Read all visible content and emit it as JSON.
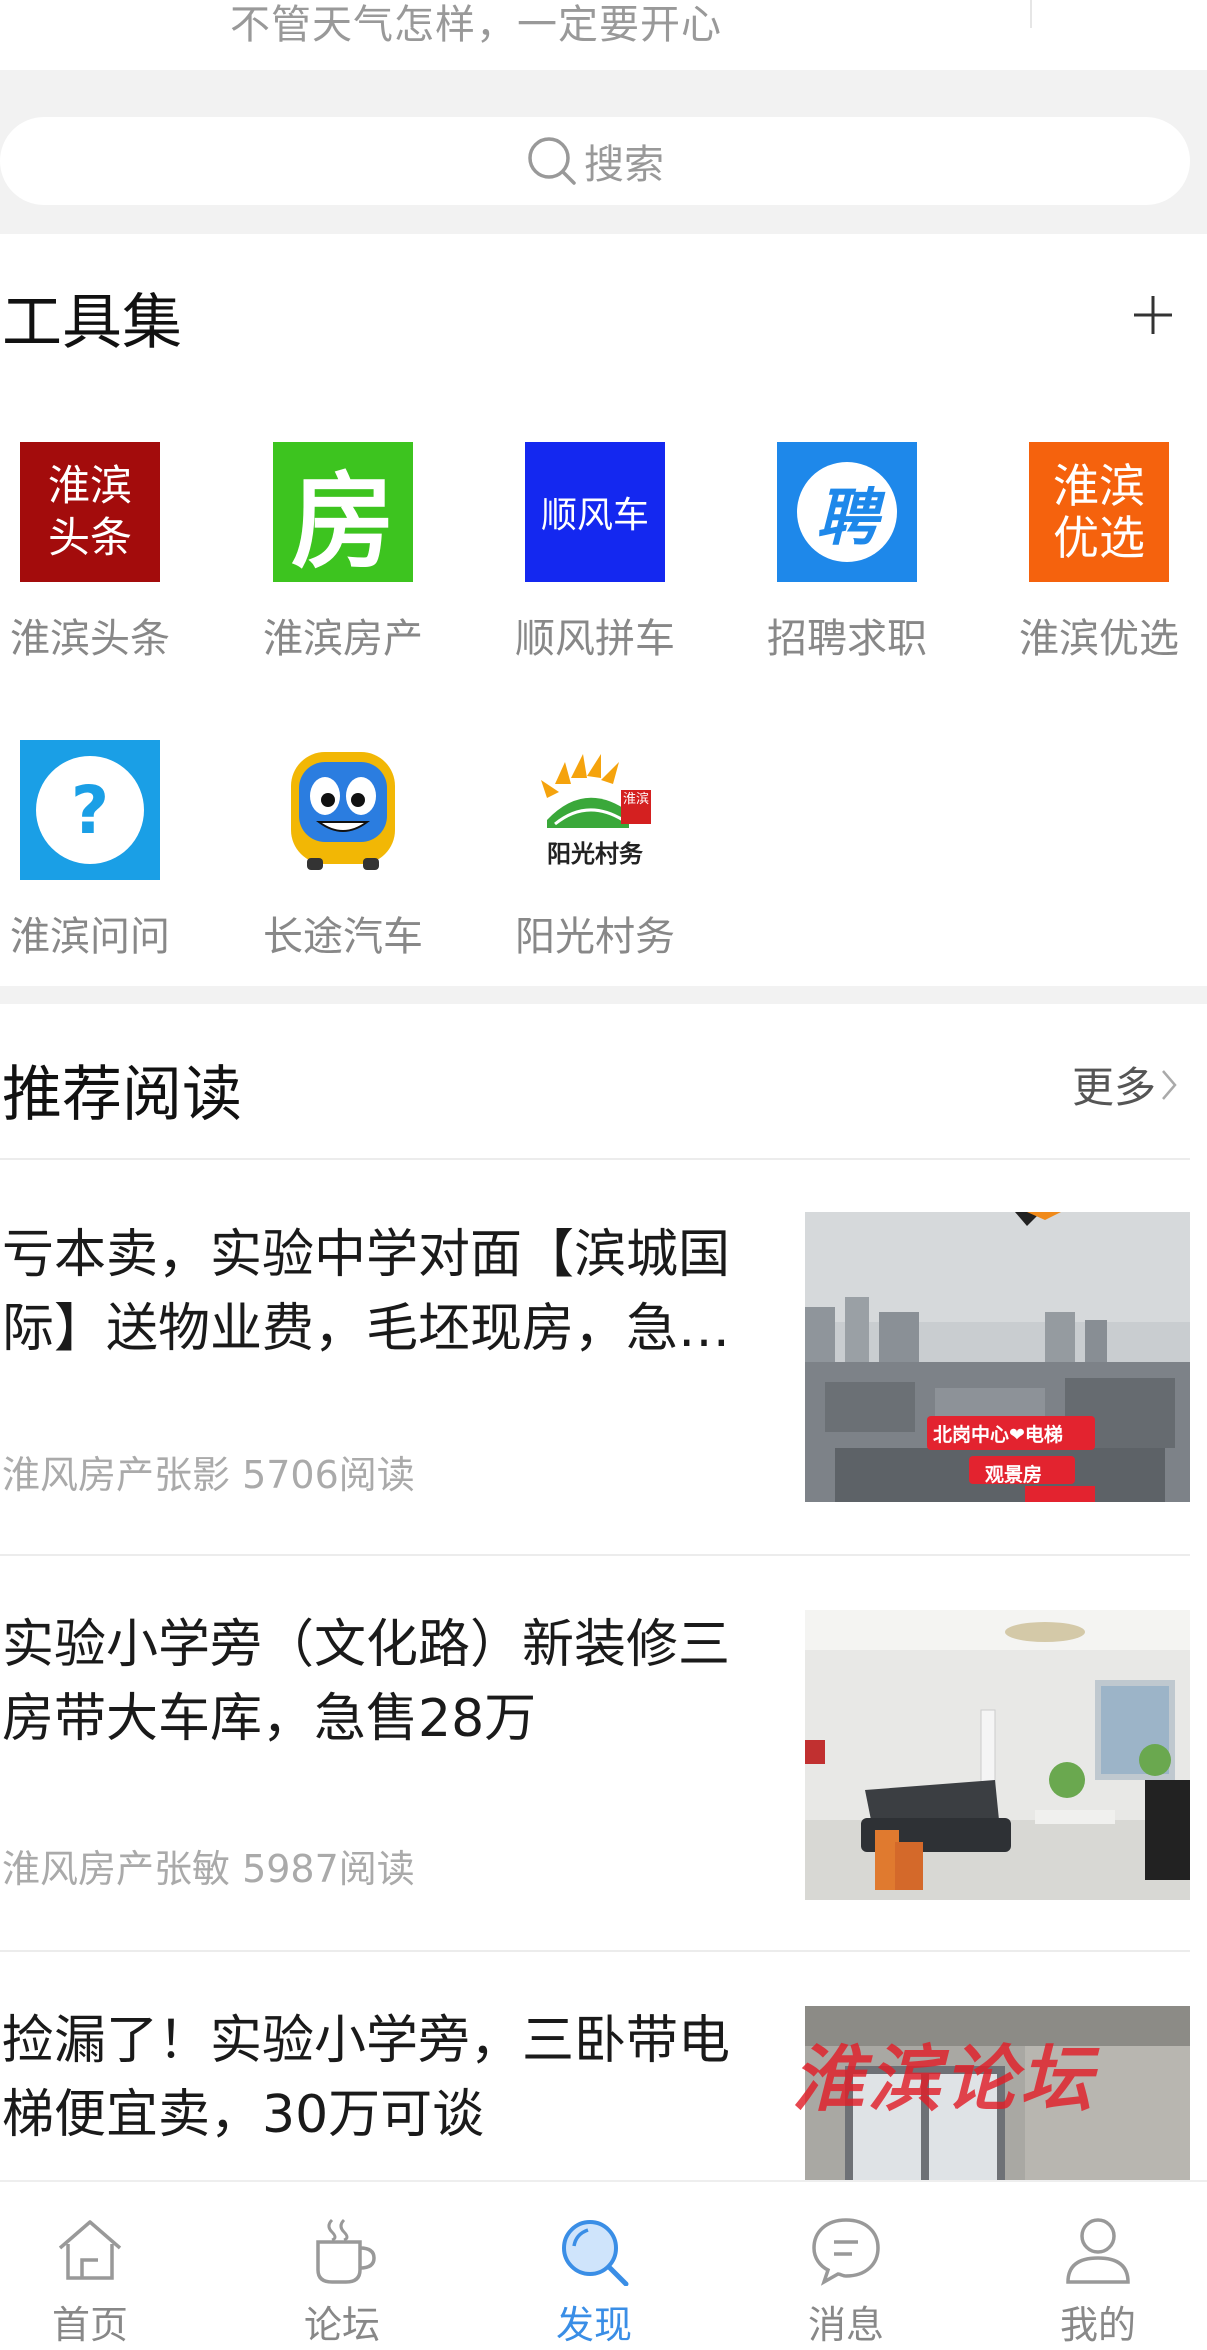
{
  "header": {
    "motto": "不管天气怎样，一定要开心"
  },
  "search": {
    "placeholder": "搜索"
  },
  "tools": {
    "title": "工具集",
    "items": [
      {
        "label": "淮滨头条",
        "tile_text": "淮滨头条",
        "icon": "huaibin-news-icon",
        "color": "#a30c0c"
      },
      {
        "label": "淮滨房产",
        "tile_text": "房",
        "icon": "house-icon",
        "color": "#3dc41f"
      },
      {
        "label": "顺风拼车",
        "tile_text": "顺风车",
        "icon": "carpool-icon",
        "color": "#1428f0"
      },
      {
        "label": "招聘求职",
        "tile_text": "聘",
        "icon": "recruit-icon",
        "color": "#1e88ea"
      },
      {
        "label": "淮滨优选",
        "tile_text": "淮滨优选",
        "icon": "select-icon",
        "color": "#f5620d"
      },
      {
        "label": "淮滨问问",
        "tile_text": "?",
        "icon": "question-icon",
        "color": "#1a9fe6"
      },
      {
        "label": "长途汽车",
        "icon": "bus-icon",
        "color": "#f2b705"
      },
      {
        "label": "阳光村务",
        "tile_text": "阳光村务",
        "badge_text": "淮滨",
        "icon": "sunshine-village-icon",
        "color": "#f5a30d"
      }
    ]
  },
  "reads": {
    "title": "推荐阅读",
    "more_label": "更多",
    "articles": [
      {
        "title": "亏本卖，实验中学对面【滨城国际】送物业费，毛坯现房，急…",
        "meta": "淮风房产张影 5706阅读",
        "overlay_1": "北岗中心❤电梯",
        "overlay_2": "观景房"
      },
      {
        "title": "实验小学旁（文化路）新装修三房带大车库，急售28万",
        "meta": "淮风房产张敏 5987阅读"
      },
      {
        "title": "捡漏了！实验小学旁，三卧带电梯便宜卖，30万可谈",
        "watermark": "淮滨论坛"
      }
    ]
  },
  "tabbar": {
    "accent": "#3a8ee6",
    "tabs": [
      {
        "label": "首页",
        "icon": "home-icon"
      },
      {
        "label": "论坛",
        "icon": "coffee-cup-icon"
      },
      {
        "label": "发现",
        "icon": "discover-icon",
        "active": true
      },
      {
        "label": "消息",
        "icon": "message-icon"
      },
      {
        "label": "我的",
        "icon": "profile-icon"
      }
    ]
  }
}
